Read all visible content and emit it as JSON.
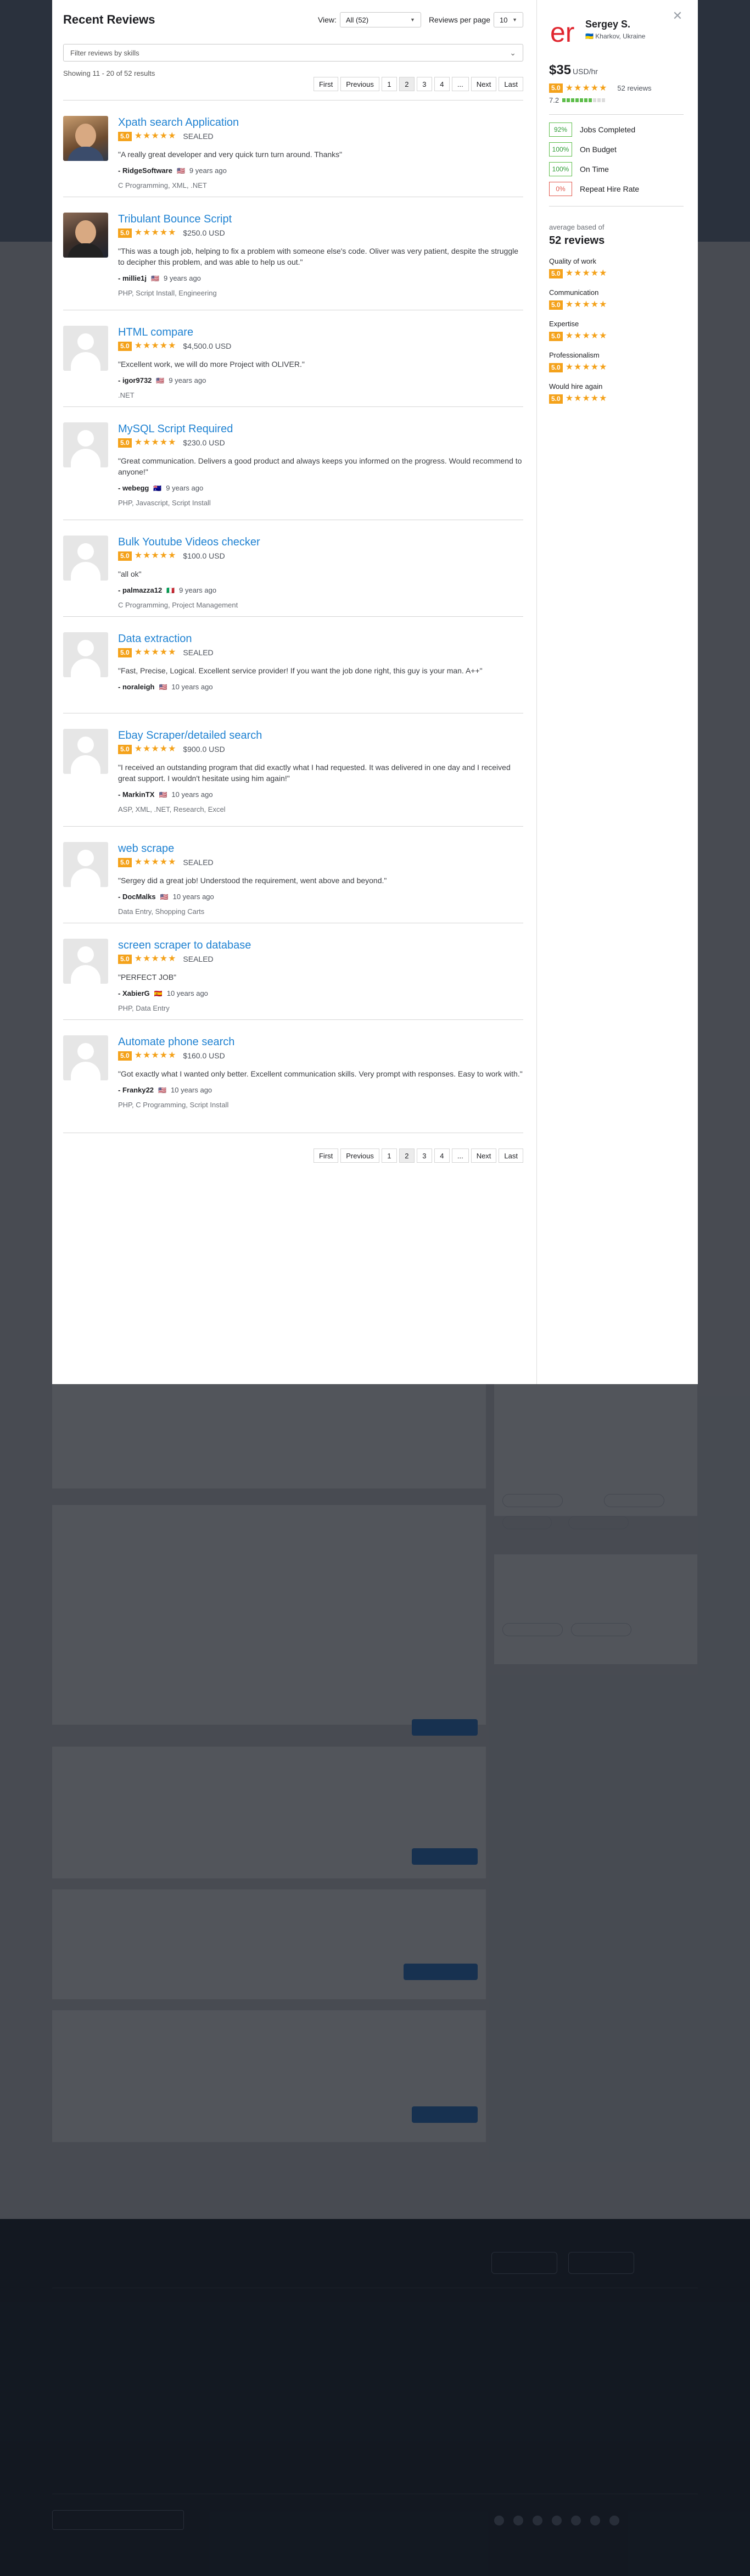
{
  "modal": {
    "title": "Recent Reviews",
    "view_label": "View:",
    "view_value": "All (52)",
    "per_page_label": "Reviews per page",
    "per_page_value": "10",
    "filter_placeholder": "Filter reviews by skills",
    "showing": "Showing 11 - 20 of 52 results",
    "pager": [
      "First",
      "Previous",
      "1",
      "2",
      "3",
      "4",
      "...",
      "Next",
      "Last"
    ],
    "pager_current": "2",
    "reviews": [
      {
        "project": "Xpath search Application",
        "score": "5.0",
        "amount": "SEALED",
        "quote": "\"A really great developer and very quick turn turn around. Thanks\"",
        "user": "RidgeSoftware",
        "flag": "🇺🇸",
        "ago": "9 years ago",
        "skills": "C Programming, XML, .NET",
        "avatar": "photo"
      },
      {
        "project": "Tribulant Bounce Script",
        "score": "5.0",
        "amount": "$250.0 USD",
        "quote": "\"This was a tough job, helping to fix a problem with someone else's code. Oliver was very patient, despite the struggle to decipher this problem, and was able to help us out.\"",
        "user": "millie1j",
        "flag": "🇺🇸",
        "ago": "9 years ago",
        "skills": "PHP, Script Install, Engineering",
        "avatar": "photo"
      },
      {
        "project": "HTML compare",
        "score": "5.0",
        "amount": "$4,500.0 USD",
        "quote": "\"Excellent work, we will do more Project with OLIVER.\"",
        "user": "igor9732",
        "flag": "🇺🇸",
        "ago": "9 years ago",
        "skills": ".NET",
        "avatar": "placeholder"
      },
      {
        "project": "MySQL Script Required",
        "score": "5.0",
        "amount": "$230.0 USD",
        "quote": "\"Great communication. Delivers a good product and always keeps you informed on the progress. Would recommend to anyone!\"",
        "user": "webegg",
        "flag": "🇦🇺",
        "ago": "9 years ago",
        "skills": "PHP, Javascript, Script Install",
        "avatar": "placeholder"
      },
      {
        "project": "Bulk Youtube Videos checker",
        "score": "5.0",
        "amount": "$100.0 USD",
        "quote": "\"all ok\"",
        "user": "palmazza12",
        "flag": "🇮🇹",
        "ago": "9 years ago",
        "skills": "C Programming, Project Management",
        "avatar": "placeholder"
      },
      {
        "project": "Data extraction",
        "score": "5.0",
        "amount": "SEALED",
        "quote": "\"Fast, Precise, Logical. Excellent service provider! If you want the job done right, this guy is your man. A++\"",
        "user": "noraleigh",
        "flag": "🇺🇸",
        "ago": "10 years ago",
        "skills": "",
        "avatar": "placeholder"
      },
      {
        "project": "Ebay Scraper/detailed search",
        "score": "5.0",
        "amount": "$900.0 USD",
        "quote": "\"I received an outstanding program that did exactly what I had requested. It was delivered in one day and I received great support. I wouldn't hesitate using him again!\"",
        "user": "MarkinTX",
        "flag": "🇺🇸",
        "ago": "10 years ago",
        "skills": "ASP, XML, .NET, Research, Excel",
        "avatar": "placeholder"
      },
      {
        "project": "web scrape",
        "score": "5.0",
        "amount": "SEALED",
        "quote": "\"Sergey did a great job! Understood the requirement, went above and beyond.\"",
        "user": "DocMalks",
        "flag": "🇺🇸",
        "ago": "10 years ago",
        "skills": "Data Entry, Shopping Carts",
        "avatar": "placeholder"
      },
      {
        "project": "screen scraper to database",
        "score": "5.0",
        "amount": "SEALED",
        "quote": "\"PERFECT JOB\"",
        "user": "XabierG",
        "flag": "🇪🇸",
        "ago": "10 years ago",
        "skills": "PHP, Data Entry",
        "avatar": "placeholder"
      },
      {
        "project": "Automate phone search",
        "score": "5.0",
        "amount": "$160.0 USD",
        "quote": "\"Got exactly what I wanted only better. Excellent communication skills. Very prompt with responses. Easy to work with.\"",
        "user": "Franky22",
        "flag": "🇺🇸",
        "ago": "10 years ago",
        "skills": "PHP, C Programming, Script Install",
        "avatar": "placeholder"
      }
    ]
  },
  "profile": {
    "name": "Sergey S.",
    "flag": "🇺🇦",
    "location": "Kharkov, Ukraine",
    "rate": "$35",
    "rate_unit": "USD/hr",
    "score": "5.0",
    "reviews_count": "52 reviews",
    "sub_score": "7.2",
    "sub_score_fraction": 0.7,
    "stats": [
      {
        "value": "92%",
        "label": "Jobs Completed",
        "tone": "good"
      },
      {
        "value": "100%",
        "label": "On Budget",
        "tone": "good"
      },
      {
        "value": "100%",
        "label": "On Time",
        "tone": "good"
      },
      {
        "value": "0%",
        "label": "Repeat Hire Rate",
        "tone": "bad"
      }
    ],
    "avg_label": "average based of",
    "avg_count": "52 reviews",
    "categories": [
      {
        "label": "Quality of work",
        "score": "5.0"
      },
      {
        "label": "Communication",
        "score": "5.0"
      },
      {
        "label": "Expertise",
        "score": "5.0"
      },
      {
        "label": "Professionalism",
        "score": "5.0"
      },
      {
        "label": "Would hire again",
        "score": "5.0"
      }
    ],
    "logo_text": "er",
    "logo_color": "#e0262f"
  },
  "theme": {
    "accent": "#1f82d2",
    "star": "#f4a21b",
    "good": "#5dbd4a",
    "bad": "#e2574c"
  }
}
